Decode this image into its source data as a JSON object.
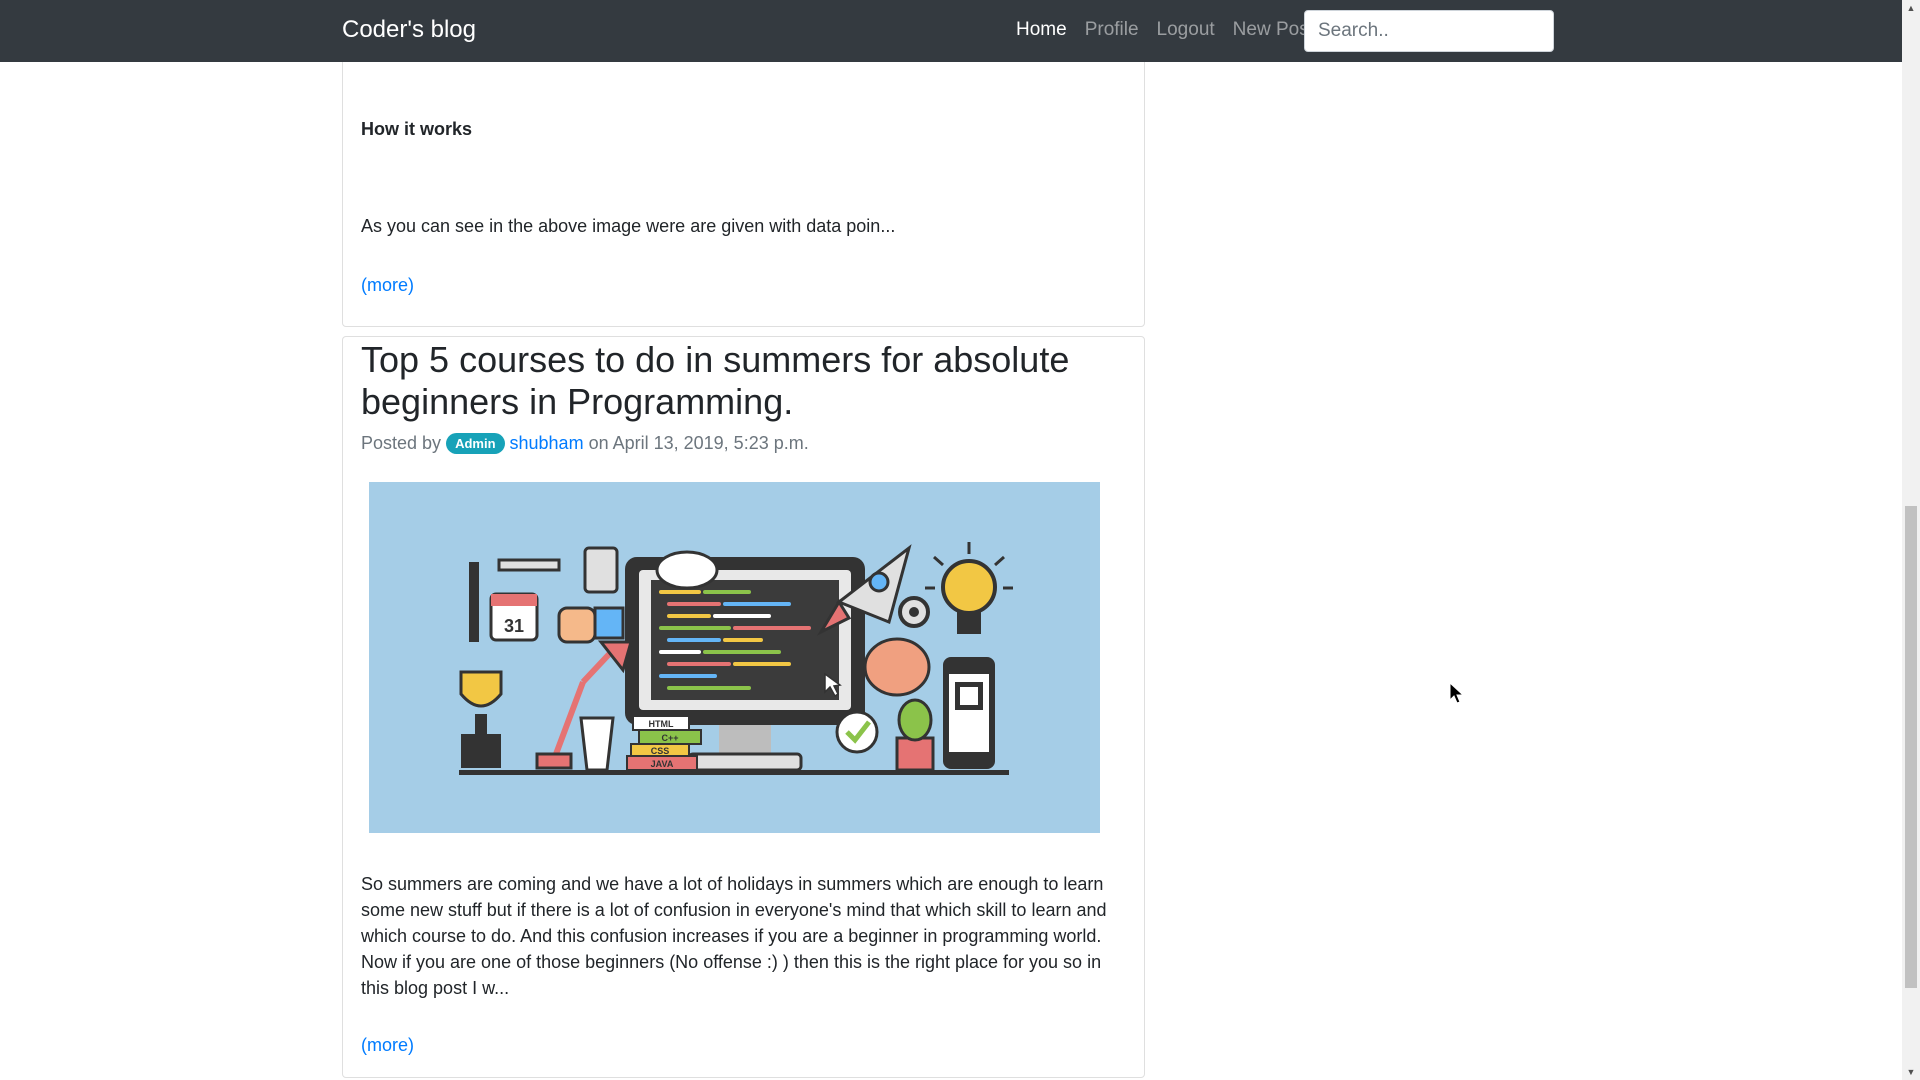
{
  "navbar": {
    "brand": "Coder's blog",
    "links": [
      "Home",
      "Profile",
      "Logout",
      "New Post"
    ],
    "active_link": "Home",
    "search_placeholder": "Search.."
  },
  "post_previous": {
    "subheading": "How it works",
    "excerpt": "As you can see in the above image were are given with data poin...",
    "more_label": "(more)"
  },
  "post_current": {
    "title": "Top 5 courses to do in summers for absolute beginners in Programming.",
    "meta": {
      "posted_by": "Posted by",
      "role_badge": "Admin",
      "author": "shubham",
      "date_text": "on April 13, 2019, 5:23 p.m."
    },
    "image_labels": [
      "HTML",
      "C++",
      "CSS",
      "JAVA",
      "31"
    ],
    "excerpt": "So summers are coming and we have a lot of holidays in summers which are enough to learn some new stuff but if there is a lot of confusion in everyone's mind that which skill to learn and which course to do. And this confusion increases if you are a beginner in programming world. Now if you are one of those beginners (No offense :) ) then this is the right place for you so in this blog post I w...",
    "more_label": "(more)"
  },
  "colors": {
    "navbar_bg": "#343a40",
    "link": "#007bff",
    "badge": "#17a2b8",
    "image_bg": "#a5cde7"
  }
}
